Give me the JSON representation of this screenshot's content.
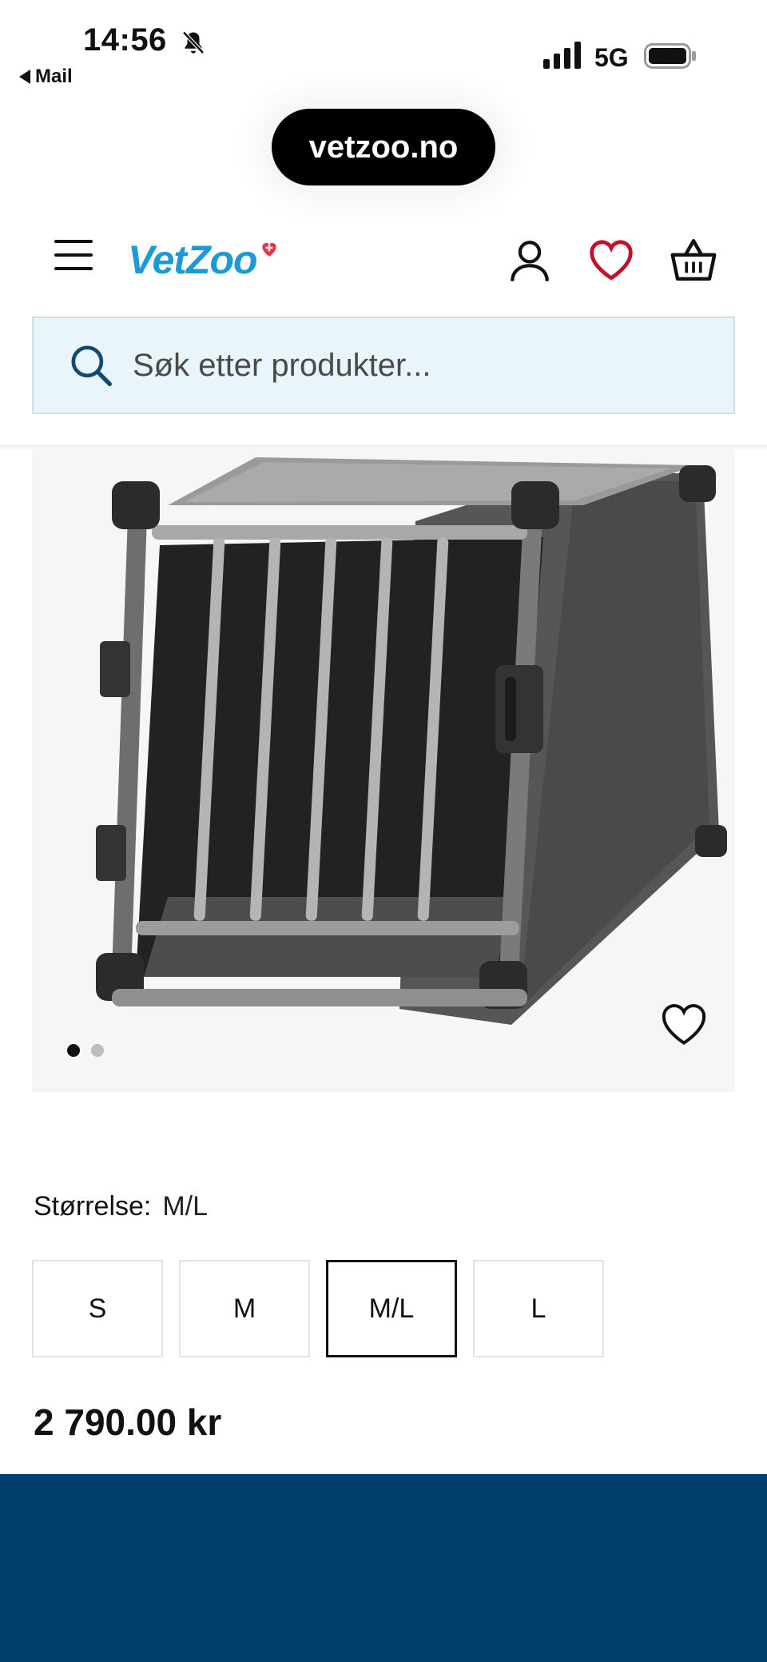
{
  "status_bar": {
    "time": "14:56",
    "back_app": "Mail",
    "network": "5G",
    "icons": [
      "bell-slash-icon",
      "signal-icon",
      "battery-icon"
    ]
  },
  "browser": {
    "url": "vetzoo.no"
  },
  "header": {
    "logo_text": "VetZoo",
    "icons": [
      "menu-icon",
      "user-icon",
      "heart-icon",
      "basket-icon"
    ],
    "accent_color": "#1d9ad6",
    "wishlist_color": "#c0122a"
  },
  "search": {
    "placeholder": "Søk etter produkter..."
  },
  "product": {
    "image_alt": "Aluminium dog transport crate",
    "carousel": {
      "total": 2,
      "active_index": 0
    },
    "size_label": "Størrelse:",
    "selected_size": "M/L",
    "sizes": [
      "S",
      "M",
      "M/L",
      "L"
    ],
    "price": "2 790.00 kr"
  },
  "colors": {
    "footer_band": "#003f6d",
    "search_bg": "#eaf4fb"
  }
}
